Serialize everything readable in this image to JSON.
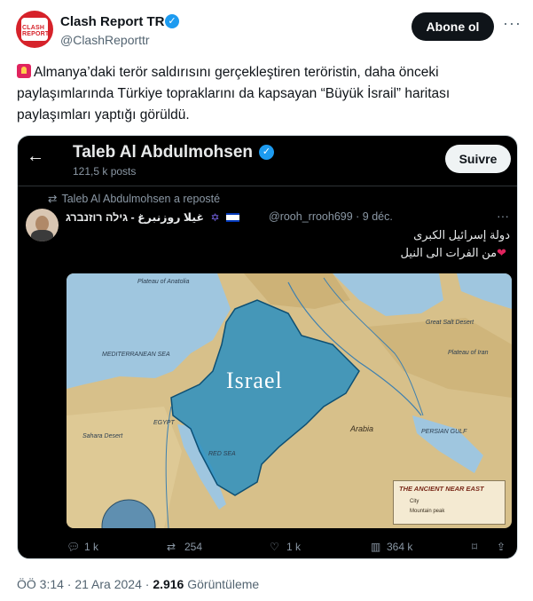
{
  "tweet": {
    "author_name": "Clash Report TR",
    "author_handle": "@ClashReporttr",
    "avatar_text": "CLASH REPORT",
    "follow_label": "Abone ol",
    "more_label": "···",
    "text": "Almanya’daki terör saldırısını gerçekleştiren teröristin, daha önceki paylaşımlarında Türkiye topraklarını da kapsayan “Büyük İsrail” haritası paylaşımları yaptığı görüldü.",
    "time": "ÖÖ 3:14 · 21 Ara 2024 · ",
    "views_count": "2.916",
    "views_label": " Görüntüleme"
  },
  "embed": {
    "back_icon": "←",
    "profile_name": "Taleb Al Abdulmohsen",
    "posts_count": "121,5 k posts",
    "follow_label": "Suivre",
    "repost_text": "Taleb Al Abdulmohsen a reposté",
    "user_display": "غيلا روزنبرغ - גילה רוזנברג",
    "meta": "@rooh_rrooh699 · 9 déc.",
    "arabic_line1": "دولة إسرائيل الكبرى",
    "arabic_line2": "من الفرات الى النيل",
    "map": {
      "israel_label": "Israel",
      "arabia_label": "Arabia",
      "legend_title": "THE ANCIENT NEAR EAST",
      "legend_item1": "City",
      "legend_item2": "Mountain peak",
      "labels": {
        "med_sea": "MEDITERRANEAN SEA",
        "sahara": "Sahara Desert",
        "anatolia": "Plateau of Anatolia",
        "persian_gulf": "PERSIAN GULF",
        "great_salt": "Great Salt Desert",
        "iran": "Plateau of Iran",
        "red_sea": "RED SEA",
        "egypt": "EGYPT"
      }
    },
    "actions": {
      "replies": "1 k",
      "reposts": "254",
      "likes": "1 k",
      "views": "364 k"
    }
  }
}
